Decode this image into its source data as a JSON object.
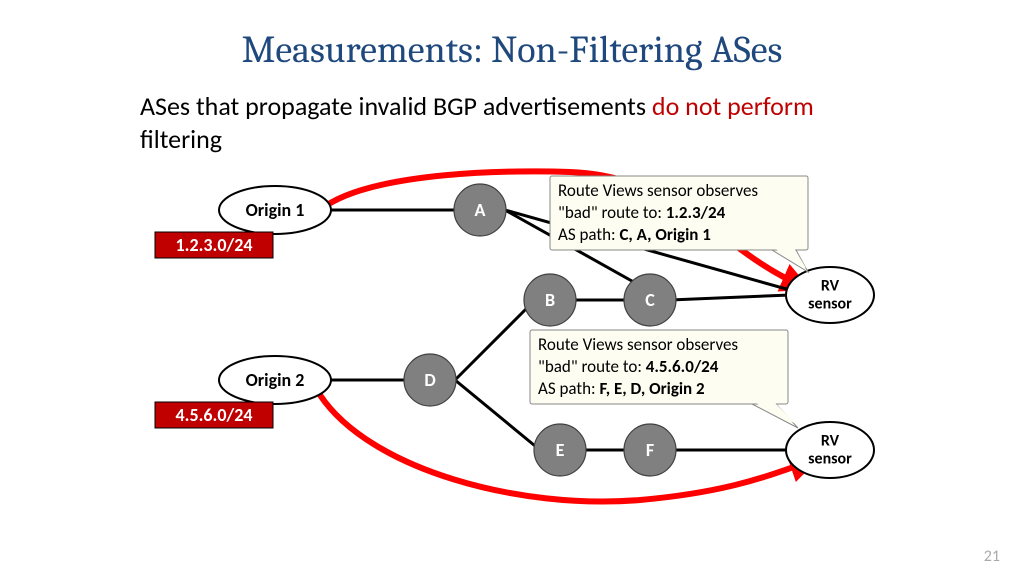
{
  "title": "Measurements: Non-Filtering ASes",
  "subtitle_prefix": "ASes that propagate invalid BGP advertisements ",
  "subtitle_red": "do not perform",
  "subtitle_suffix": " filtering",
  "slide_number": "21",
  "origins": {
    "origin1": "Origin 1",
    "origin2": "Origin 2"
  },
  "prefixes": {
    "p1": "1.2.3.0/24",
    "p2": "4.5.6.0/24"
  },
  "nodes": {
    "a": "A",
    "b": "B",
    "c": "C",
    "d": "D",
    "e": "E",
    "f": "F"
  },
  "rv_label_line1": "RV",
  "rv_label_line2": "sensor",
  "callout1": {
    "line1": "Route Views sensor observes",
    "line2_pre": "\"bad\" route to: ",
    "line2_bold": "1.2.3/24",
    "line3_pre": "AS path: ",
    "line3_bold": "C, A, Origin 1"
  },
  "callout2": {
    "line1": "Route Views sensor observes",
    "line2_pre": "\"bad\" route to: ",
    "line2_bold": "4.5.6.0/24",
    "line3_pre": "AS path: ",
    "line3_bold": "F, E, D, Origin 2"
  }
}
